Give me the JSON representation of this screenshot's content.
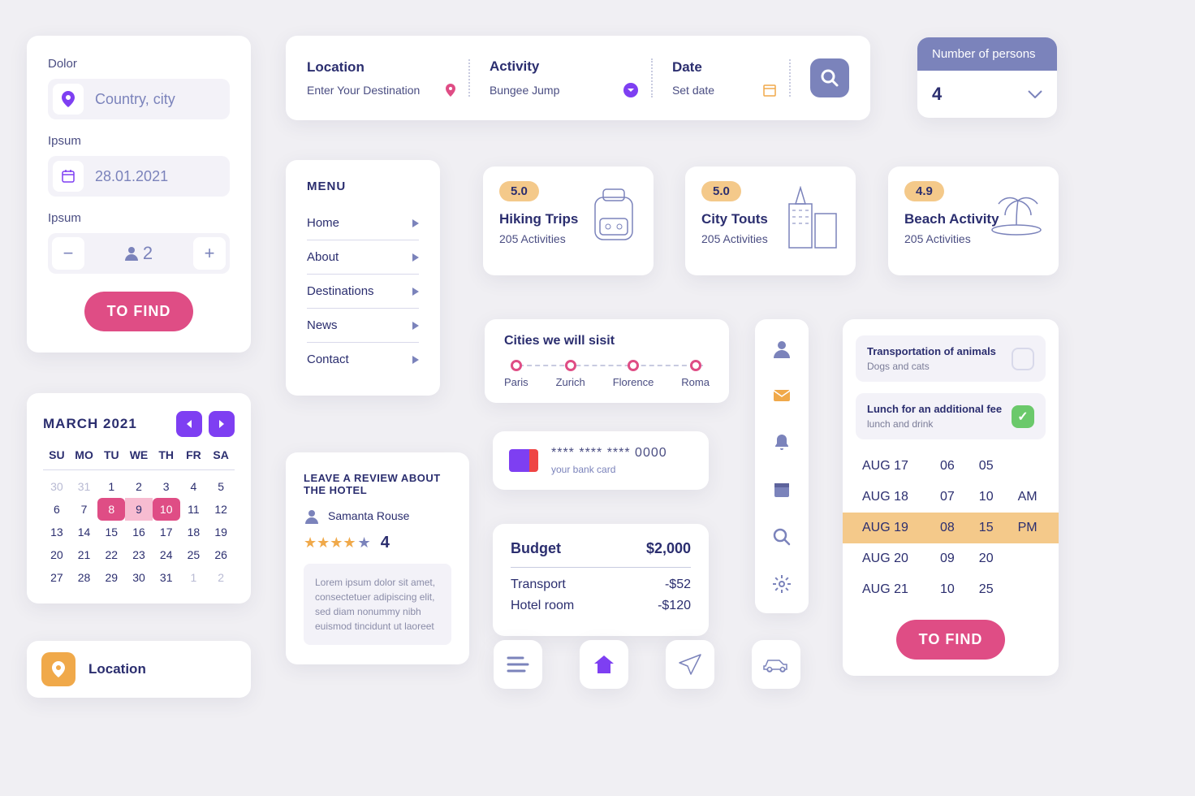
{
  "search_panel": {
    "f1_label": "Dolor",
    "f1_placeholder": "Country, city",
    "f2_label": "Ipsum",
    "f2_value": "28.01.2021",
    "f3_label": "Ipsum",
    "guests": "2",
    "find": "TO FIND"
  },
  "topbar": {
    "location_label": "Location",
    "location_value": "Enter Your Destination",
    "activity_label": "Activity",
    "activity_value": "Bungee Jump",
    "date_label": "Date",
    "date_value": "Set date"
  },
  "persons": {
    "label": "Number of persons",
    "value": "4"
  },
  "menu": {
    "title": "MENU",
    "items": [
      "Home",
      "About",
      "Destinations",
      "News",
      "Contact"
    ]
  },
  "activities": [
    {
      "rating": "5.0",
      "title": "Hiking Trips",
      "sub": "205 Activities"
    },
    {
      "rating": "5.0",
      "title": "City Touts",
      "sub": "205 Activities"
    },
    {
      "rating": "4.9",
      "title": "Beach Activity",
      "sub": "205 Activities"
    }
  ],
  "cities": {
    "title": "Cities we will sisit",
    "list": [
      "Paris",
      "Zurich",
      "Florence",
      "Roma"
    ]
  },
  "bank": {
    "number": "**** **** **** 0000",
    "sub": "your bank card"
  },
  "budget": {
    "title": "Budget",
    "total": "$2,000",
    "rows": [
      [
        "Transport",
        "-$52"
      ],
      [
        "Hotel room",
        "-$120"
      ]
    ]
  },
  "calendar": {
    "title": "MARCH 2021",
    "dow": [
      "SU",
      "MO",
      "TU",
      "WE",
      "TH",
      "FR",
      "SA"
    ],
    "prev": [
      "30",
      "31"
    ],
    "days": [
      "1",
      "2",
      "3",
      "4",
      "5",
      "6",
      "7",
      "8",
      "9",
      "10",
      "11",
      "12",
      "13",
      "14",
      "15",
      "16",
      "17",
      "18",
      "19",
      "20",
      "21",
      "22",
      "23",
      "24",
      "25",
      "26",
      "27",
      "28",
      "29",
      "30",
      "31"
    ],
    "next": [
      "1",
      "2"
    ],
    "sel": [
      "8",
      "10"
    ],
    "range": [
      "9"
    ]
  },
  "location_pill": "Location",
  "review": {
    "title": "LEAVE A REVIEW ABOUT THE HOTEL",
    "user": "Samanta Rouse",
    "score": "4",
    "body": "Lorem ipsum dolor sit amet, consectetuer adipiscing elit, sed diam nonummy nibh euismod tincidunt ut laoreet"
  },
  "schedule": {
    "opts": [
      {
        "t": "Transportation of animals",
        "s": "Dogs and cats",
        "on": false
      },
      {
        "t": "Lunch for an additional fee",
        "s": "lunch and drink",
        "on": true
      }
    ],
    "rows": [
      [
        "AUG 17",
        "06",
        "05",
        ""
      ],
      [
        "AUG 18",
        "07",
        "10",
        "AM"
      ],
      [
        "AUG 19",
        "08",
        "15",
        "PM"
      ],
      [
        "AUG 20",
        "09",
        "20",
        ""
      ],
      [
        "AUG 21",
        "10",
        "25",
        ""
      ]
    ],
    "hl": 2,
    "find": "TO FIND"
  }
}
